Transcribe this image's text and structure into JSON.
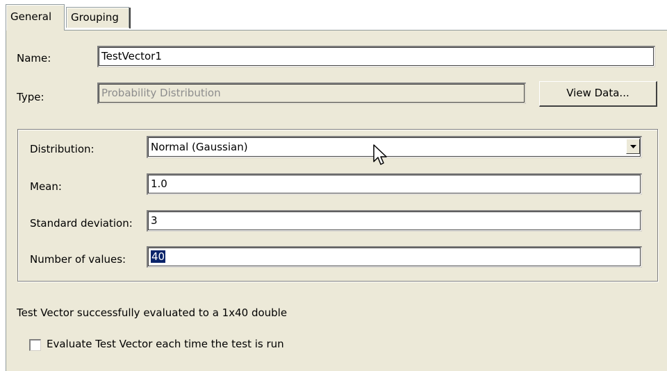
{
  "tabs": [
    {
      "label": "General",
      "active": true
    },
    {
      "label": "Grouping",
      "active": false
    }
  ],
  "fields": {
    "name_label": "Name:",
    "name_value": "TestVector1",
    "type_label": "Type:",
    "type_value": "Probability Distribution",
    "view_data_label": "View Data..."
  },
  "distribution": {
    "distribution_label": "Distribution:",
    "distribution_value": "Normal (Gaussian)",
    "mean_label": "Mean:",
    "mean_value": "1.0",
    "std_label": "Standard deviation:",
    "std_value": "3",
    "count_label": "Number of values:",
    "count_value": "40"
  },
  "status": {
    "message": "Test Vector successfully evaluated to a 1x40 double"
  },
  "options": {
    "evaluate_label": "Evaluate Test Vector each time the test is run",
    "evaluate_checked": false
  },
  "icons": {
    "dropdown": "chevron-down-icon",
    "cursor": "mouse-pointer-icon"
  },
  "colors": {
    "panel_bg": "#ece9d8",
    "selection_bg": "#0a246a",
    "disabled_text": "#8d8d8d"
  }
}
